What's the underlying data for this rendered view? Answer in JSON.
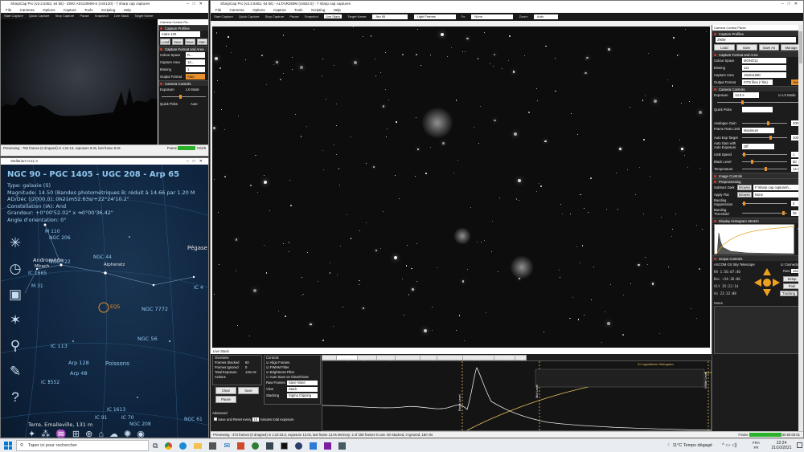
{
  "left_window": {
    "title": "SharpCap Pro (v3.2.6452, 64 bit) - ZWO ASI120MM-S (ASI120) - 7 sharp cap captures",
    "menu": [
      "File",
      "Cameras",
      "Options",
      "Capture",
      "Tools",
      "Scripting",
      "Help"
    ],
    "toolbar": [
      "Start Capture",
      "Quick Capture",
      "Stop Capture",
      "Pause",
      "Snapshot",
      "Live Stack",
      "Target Name:"
    ],
    "panel_title": "Camera Control Pa...",
    "capture_profiles": "Capture Profiles",
    "profile_value": "Autre 120",
    "profile_buttons": [
      "Load",
      "Save",
      "Save",
      "Man"
    ],
    "format_header": "Capture Format and Area",
    "rows": [
      {
        "label": "Colour Space",
        "value": "R..."
      },
      {
        "label": "Capture Area",
        "value": "12..."
      },
      {
        "label": "Binning",
        "value": "1"
      },
      {
        "label": "Output Format",
        "value": "Auto"
      }
    ],
    "camera_controls": "Camera Controls",
    "exposure_label": "Exposure",
    "lx_mode": "LX Mode",
    "quick_picks": "Quick Picks",
    "auto_label": "Auto",
    "status": "Previewing : 755 frames (0 dropped) in 1:24:13, exposure 8.0s, last frame 8.0s",
    "frame_label": "Frame",
    "frame_value": "72/4/8"
  },
  "stellarium": {
    "title": "Stellarium 0.21.3",
    "object_title": "NGC 90 - PGC 1405 - UGC 208 - Arp 65",
    "info_lines": [
      "Type: galaxie (S)",
      "Magnitude: 14.50 (Bandes photométriques B; réduit à 14.66 par 1.20 M",
      "AD/Déc (J2000.0): 0h21m52.63s/+22°24'10.2\"",
      "Constellation (IA): And",
      "Grandeur: +0°00'52.02\" x +0°00'36.42\"",
      "Angle d'orientation: 0°"
    ],
    "labels": [
      "Andromède",
      "Mirach",
      "NGC 44",
      "Alpheratz",
      "IC 1665",
      "NGC 7772",
      "NGC 56",
      "IC 113",
      "Arp 128",
      "Arp 48",
      "Poissons",
      "IC 1613",
      "IC 91",
      "IC 70",
      "NGC 208",
      "NGC 61",
      "Pégase",
      "IC 1552",
      "M 110",
      "NGC 206",
      "M 31",
      "NGC 722",
      "EQ5",
      "IC 4"
    ],
    "location": "Terre, Emalleville, 131 m"
  },
  "main_window": {
    "title": "SharpCap Pro (v3.2.6452, 64 bit) - ALTAIR290M (USB2.0) - 7 sharp cap captures",
    "menu": [
      "File",
      "Cameras",
      "Options",
      "Capture",
      "Tools",
      "Scripting",
      "Help"
    ],
    "toolbar": [
      "Start Capture",
      "Quick Capture",
      "Stop Capture",
      "Pause",
      "Snapshot",
      "Live Stack",
      "Target Name:"
    ],
    "target_name": "Arp 65",
    "frame_type_label": "Light Frames",
    "fx_label": "Fx:",
    "fx_value": "None",
    "zoom_label": "Zoom:",
    "zoom_value": "Auto",
    "status": "Previewing : 473 frames (0 dropped) in 1:10:33.6, exposure 13.0s, last frame 13.0s  Memory: 2 of 258 frames in use.  60 Stacked, 0 Ignored, 18m 0s",
    "frame_label": "Frame",
    "frame_value": "00:00:00:01"
  },
  "live_stack": {
    "title": "Live Stack",
    "overview_label": "Overview",
    "overview_rows": [
      {
        "label": "Frames Stacked",
        "value": "60"
      },
      {
        "label": "Frames Ignored",
        "value": "0"
      },
      {
        "label": "Total Exposure",
        "value": "13m 0s"
      }
    ],
    "actions_label": "Actions",
    "buttons": [
      "Clear",
      "Save",
      "Pause"
    ],
    "advanced_label": "Advanced",
    "save_reset": "Save and Reset every",
    "save_reset_value": "10",
    "save_reset_suffix": "minutes total exposure",
    "controls_label": "Controls",
    "controls": [
      "Align Frames",
      "FWHM Filter",
      "Brightness Filter",
      "Auto Save on Clear/Close"
    ],
    "raw_frames_label": "Raw Frames",
    "raw_frames_value": "Save None",
    "view_label": "View",
    "view_value": "Stack",
    "stacking_label": "Stacking",
    "stacking_value": "Sigma Clipping",
    "tabs": [
      "Status",
      "Histogram",
      "Alignment",
      "Stacking",
      "Enhancement",
      "Guiding",
      "Filter (FWHM)",
      "Filter (Brightness)",
      "Drift Graph",
      "Log"
    ],
    "active_tab": "Histogram",
    "hist_markers": [
      "Black Level",
      "Mid Level",
      "White Level"
    ],
    "hist_legend": "Logarithmic Histogram"
  },
  "right_panel": {
    "title": "Camera Control Panel",
    "capture_profiles": "Capture Profiles",
    "profile_value": "290M",
    "profile_buttons": [
      "Load",
      "Save",
      "Save As",
      "Manage"
    ],
    "format_header": "Capture Format and Area",
    "format_rows": [
      {
        "label": "Colour Space",
        "value": "MONO12"
      },
      {
        "label": "Binning",
        "value": "1x1"
      },
      {
        "label": "Capture Area",
        "value": "1920x1080"
      },
      {
        "label": "Output Format",
        "value": "FITS files (*.fits)"
      }
    ],
    "auto_label": "Auto",
    "camera_controls": "Camera Controls",
    "exposure_label": "Exposure",
    "exposure_value": "13.0 s",
    "lx_mode": "LX Mode",
    "quick_picks": "Quick Picks",
    "analogue_gain_label": "Analogue Gain",
    "analogue_gain_value": "200",
    "frame_rate_label": "Frame Rate Limit",
    "frame_rate_value": "Maximum",
    "auto_exp_label": "Auto Exp Target",
    "auto_exp_value": "100",
    "auto_gain_label": "Auto Gain with Auto Exposure",
    "auto_gain_value": "Off",
    "usb_label": "USB Speed",
    "usb_value": "1",
    "black_level_label": "Black Level",
    "black_level_value": "50",
    "temperature_label": "Temperature",
    "temperature_value": "14.0",
    "image_controls": "Image Controls",
    "preprocessing": "Preprocessing",
    "subtract_dark_label": "Subtract Dark",
    "subtract_dark_btn": "Browse",
    "subtract_dark_value": "F:\\sharp cap captures\\...",
    "apply_flat_label": "Apply Flat",
    "apply_flat_btn": "Browse",
    "apply_flat_value": "None",
    "banding_supp_label": "Banding Suppression",
    "banding_supp_value": "0",
    "banding_thr_label": "Banding Threshold",
    "banding_thr_value": "35",
    "display_histogram": "Display Histogram Stretch",
    "scope_controls": "Scope Controls",
    "scope_name": "ASCOM GS Sky Telescope",
    "connected": "Connected",
    "rate_label": "Rate",
    "rate_value": "16x",
    "setup": "Setup",
    "park": "Park",
    "tracking": "Tracking",
    "coords": [
      {
        "label": "RA",
        "value": "1:56:07:40"
      },
      {
        "label": "Dec",
        "value": "+34:36:06"
      },
      {
        "label": "Alt",
        "value": "35:22:14"
      },
      {
        "label": "Az",
        "value": "22:32:08"
      }
    ],
    "notes_label": "Notes"
  },
  "taskbar": {
    "search_placeholder": "Taper ici pour rechercher",
    "weather": "11°C Temps dégagé",
    "lang": "FRA",
    "lang2": "FR",
    "time": "22:24",
    "date": "21/10/2021"
  }
}
